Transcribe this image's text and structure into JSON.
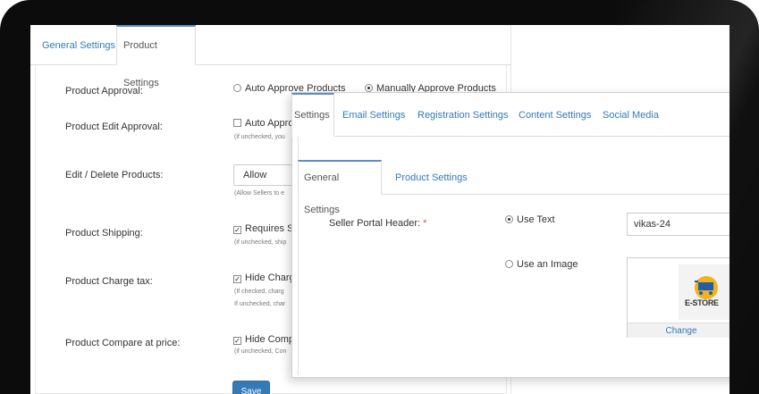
{
  "back_panel": {
    "tabs": [
      "General Settings",
      "Product Settings"
    ],
    "product_approval": {
      "label": "Product Approval:",
      "options": [
        "Auto Approve Products",
        "Manually Approve Products"
      ]
    },
    "product_edit_approval": {
      "label": "Product Edit Approval:",
      "option": "Auto Appro",
      "help": "(if unchecked, you"
    },
    "edit_delete_products": {
      "label": "Edit / Delete Products:",
      "value": "Allow",
      "help": "(Allow Sellers to e"
    },
    "product_shipping": {
      "label": "Product Shipping:",
      "option": "Requires Sh",
      "help": "(if unchecked, ship"
    },
    "product_charge_tax": {
      "label": "Product Charge tax:",
      "option": "Hide Charg",
      "help1": "(If checked, charg",
      "help2": "If unchecked, char"
    },
    "product_compare_price": {
      "label": "Product Compare at price:",
      "option": "Hide Compa",
      "help": "(if unchecked, Con"
    },
    "save_label": "Save"
  },
  "front_panel": {
    "top_tabs": [
      "Settings",
      "Email Settings",
      "Registration Settings",
      "Content Settings",
      "Social Media"
    ],
    "sub_tabs": [
      "General Settings",
      "Product Settings"
    ],
    "seller_portal_header": {
      "label": "Seller Portal Header:",
      "required_mark": "*",
      "options": [
        "Use Text",
        "Use an Image"
      ],
      "text_value": "vikas-24",
      "logo_text": "E-STORE",
      "change_label": "Change"
    }
  },
  "colors": {
    "link": "#337ab7",
    "active_tab_border": "#5b8fc2",
    "save_button": "#337ab7",
    "required": "#d9534f"
  }
}
